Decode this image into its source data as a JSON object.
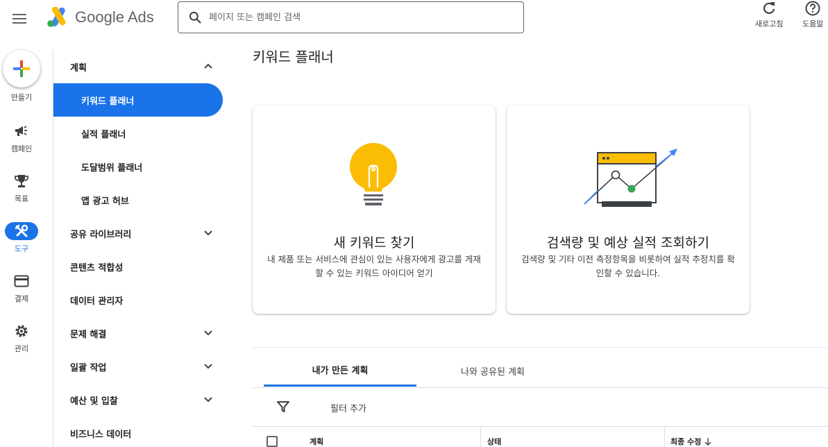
{
  "app": {
    "logo_text": "Google Ads"
  },
  "search": {
    "placeholder": "페이지 또는 캠페인 검색"
  },
  "header_actions": [
    {
      "label": "새로고침",
      "icon": "refresh-icon"
    },
    {
      "label": "도움말",
      "icon": "help-icon"
    }
  ],
  "rail": {
    "create_label": "만들기",
    "items": [
      {
        "label": "캠페인",
        "icon": "megaphone-icon"
      },
      {
        "label": "목표",
        "icon": "trophy-icon"
      },
      {
        "label": "도구",
        "icon": "tools-icon",
        "active": true
      },
      {
        "label": "결제",
        "icon": "credit-card-icon"
      },
      {
        "label": "관리",
        "icon": "gear-icon"
      }
    ]
  },
  "nav": {
    "section_planning": "계획",
    "planning_items": [
      "키워드 플래너",
      "실적 플래너",
      "도달범위 플래너",
      "앱 광고 허브"
    ],
    "items": [
      "공유 라이브러리",
      "콘텐츠 적합성",
      "데이터 관리자",
      "문제 해결",
      "일괄 작업",
      "예산 및 입찰",
      "비즈니스 데이터"
    ]
  },
  "main": {
    "title": "키워드 플래너",
    "cards": [
      {
        "title": "새 키워드 찾기",
        "desc": "내 제품 또는 서비스에 관심이 있는 사용자에게 광고를 게재할 수 있는 키워드 아이디어 얻기"
      },
      {
        "title": "검색량 및 예상 실적 조회하기",
        "desc": "검색량 및 기타 이전 측정항목을 비롯하여 실적 추정치를 확인할 수 있습니다."
      }
    ],
    "tabs": [
      "내가 만든 계획",
      "나와 공유된 계획"
    ],
    "filter_label": "필터 추가",
    "columns": [
      "계획",
      "상태",
      "최종 수정"
    ]
  },
  "colors": {
    "accent": "#1a73e8",
    "bulb": "#fbbc04",
    "chart_dot": "#34a853"
  }
}
